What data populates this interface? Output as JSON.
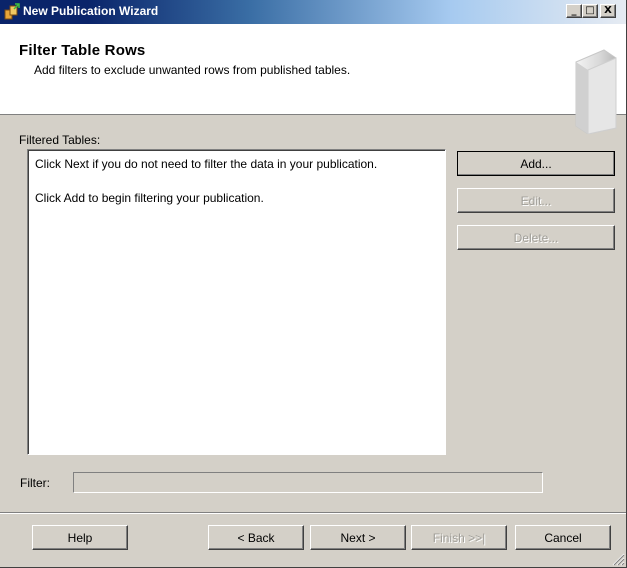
{
  "window": {
    "title": "New Publication Wizard",
    "controls": {
      "minimize": "_",
      "maximize": "□",
      "close": "X"
    }
  },
  "header": {
    "title": "Filter Table Rows",
    "subtitle": "Add filters to exclude unwanted rows from published tables."
  },
  "filtered_tables": {
    "label": "Filtered Tables:",
    "lines": [
      "Click Next if you do not need to filter the data in your publication.",
      "Click Add to begin filtering your publication."
    ]
  },
  "side_buttons": {
    "add": "Add...",
    "edit": "Edit...",
    "delete": "Delete..."
  },
  "filter": {
    "label": "Filter:",
    "value": ""
  },
  "footer_buttons": {
    "help": "Help",
    "back": "< Back",
    "next": "Next >",
    "finish": "Finish >>|",
    "cancel": "Cancel"
  },
  "icons": {
    "app": "wizard-app-icon",
    "header_art": "publication-book-icon",
    "resize": "resize-grip-icon"
  }
}
